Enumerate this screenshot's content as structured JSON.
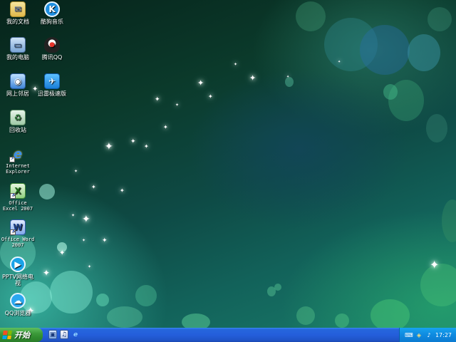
{
  "desktop": {
    "icons": [
      {
        "label": "我的文档",
        "icon": "documents-folder-icon"
      },
      {
        "label": "酷狗音乐",
        "icon": "kugou-music-icon"
      },
      {
        "label": "我的电脑",
        "icon": "computer-icon"
      },
      {
        "label": "腾讯QQ",
        "icon": "qq-penguin-icon"
      },
      {
        "label": "网上邻居",
        "icon": "network-places-icon"
      },
      {
        "label": "迅雷极速版",
        "icon": "xunlei-bird-icon"
      },
      {
        "label": "回收站",
        "icon": "recycle-bin-icon"
      },
      {
        "label": "Internet Explorer",
        "icon": "internet-explorer-icon"
      },
      {
        "label": "Office Excel 2007",
        "icon": "excel-icon"
      },
      {
        "label": "Office Word 2007",
        "icon": "word-icon"
      },
      {
        "label": "PPTV网络电视",
        "icon": "pptv-icon"
      },
      {
        "label": "QQ浏览器",
        "icon": "qq-browser-icon"
      }
    ]
  },
  "taskbar": {
    "start_label": "开始",
    "quick_launch": [
      {
        "icon": "show-desktop-icon"
      },
      {
        "icon": "media-player-icon"
      },
      {
        "icon": "ie-quicklaunch-icon"
      }
    ],
    "tray": {
      "icons": [
        "keyboard-icon",
        "security-shield-icon",
        "volume-icon"
      ],
      "clock": "17:27"
    },
    "colors": {
      "bar": "#245edb",
      "start": "#3c9a3a",
      "tray": "#0f8ae0"
    }
  }
}
